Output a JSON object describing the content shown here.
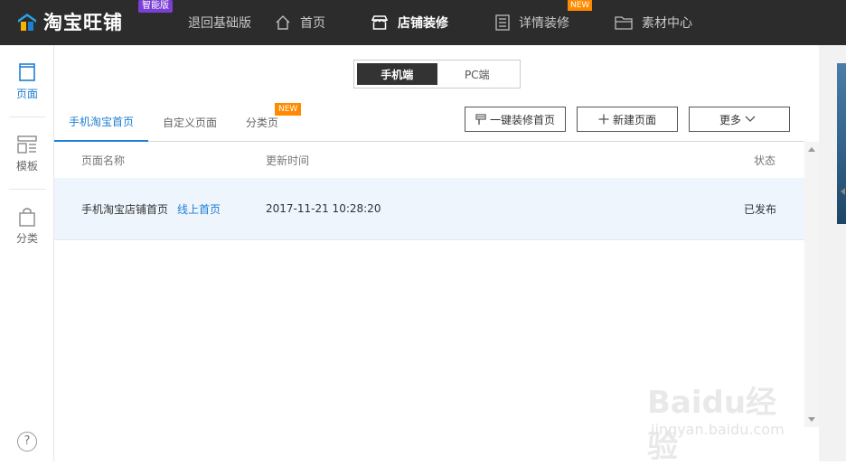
{
  "app": {
    "logo_text": "淘宝旺铺",
    "logo_badge": "智能版"
  },
  "nav": {
    "back_basic": "退回基础版",
    "home": "首页",
    "store_decor": "店铺装修",
    "detail_decor": "详情装修",
    "detail_badge": "NEW",
    "materials": "素材中心"
  },
  "rail": {
    "pages": "页面",
    "templates": "模板",
    "categories": "分类",
    "help": "?"
  },
  "device_toggle": {
    "mobile": "手机端",
    "pc": "PC端",
    "selected": "手机端"
  },
  "tabs": [
    {
      "label": "手机淘宝首页",
      "active": true
    },
    {
      "label": "自定义页面",
      "active": false
    },
    {
      "label": "分类页",
      "active": false,
      "badge": "NEW"
    }
  ],
  "actions": {
    "one_click": "一键装修首页",
    "new_page": "新建页面",
    "more": "更多"
  },
  "table": {
    "columns": [
      "页面名称",
      "更新时间",
      "状态"
    ],
    "rows": [
      {
        "name": "手机淘宝店铺首页",
        "link": "线上首页",
        "updated": "2017-11-21 10:28:20",
        "status": "已发布"
      }
    ]
  },
  "watermark": {
    "main": "Baidu经验",
    "sub": "jingyan.baidu.com"
  },
  "colors": {
    "topbar": "#2c2c2c",
    "accent": "#1e7fd0",
    "badge_purple": "#7b3fd6",
    "badge_orange": "#ff8a00",
    "row_highlight": "#eef5fd"
  }
}
